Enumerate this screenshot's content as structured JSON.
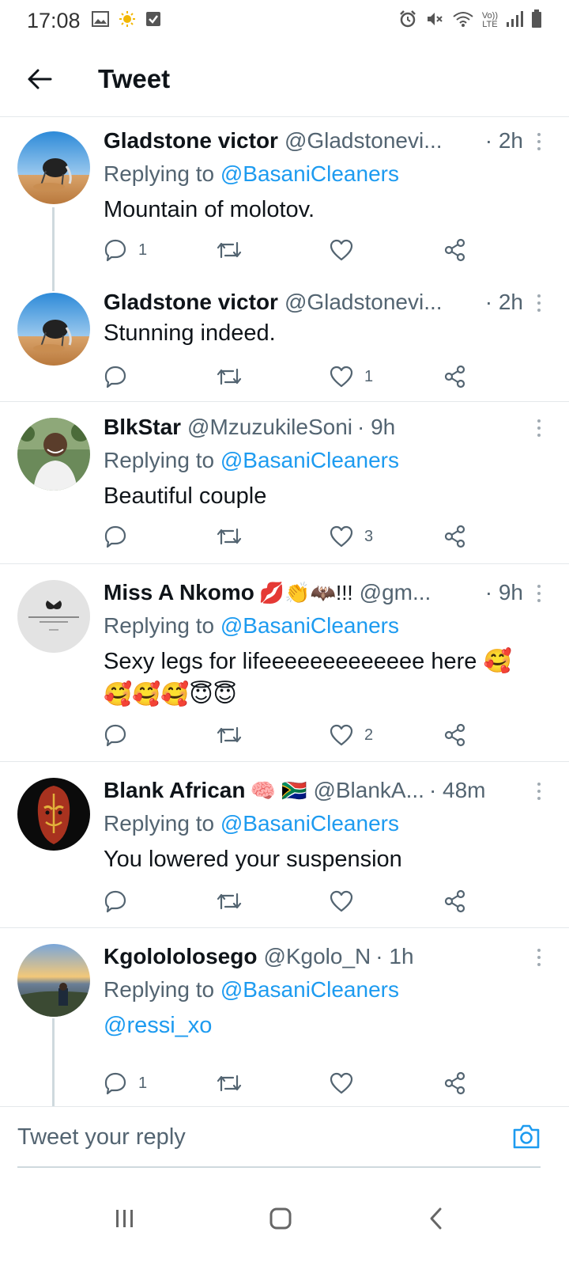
{
  "status_bar": {
    "time": "17:08",
    "left_icons": [
      "image-icon",
      "sun-icon",
      "check-box-icon"
    ],
    "right_icons": [
      "alarm-icon",
      "mute-icon",
      "wifi-icon",
      "volte-icon",
      "signal-icon",
      "battery-icon"
    ],
    "volte_label": "Vo))\nLTE"
  },
  "header": {
    "title": "Tweet"
  },
  "tweets": [
    {
      "name": "Gladstone victor",
      "emojis": "",
      "handle": "@Gladstonevi...",
      "time": "· 2h",
      "replying_prefix": "Replying to ",
      "replying_to": "@BasaniCleaners",
      "text": "Mountain of molotov.",
      "counts": {
        "reply": "1",
        "retweet": "",
        "like": ""
      }
    },
    {
      "name": "Gladstone victor",
      "emojis": "",
      "handle": "@Gladstonevi...",
      "time": "· 2h",
      "text": "Stunning indeed.",
      "counts": {
        "reply": "",
        "retweet": "",
        "like": "1"
      }
    },
    {
      "name": "BlkStar",
      "emojis": "",
      "handle": "@MzuzukileSoni",
      "time": "· 9h",
      "replying_prefix": "Replying to ",
      "replying_to": "@BasaniCleaners",
      "text": "Beautiful couple",
      "counts": {
        "reply": "",
        "retweet": "",
        "like": "3"
      }
    },
    {
      "name": "Miss A Nkomo",
      "emojis": "💋👏🦇!!!",
      "handle": "@gm...",
      "time": "· 9h",
      "replying_prefix": "Replying to ",
      "replying_to": "@BasaniCleaners",
      "text_line1": "Sexy legs for lifeeeeeeeeeeeee here 🥰",
      "text_line2": "🥰🥰🥰😇😇",
      "counts": {
        "reply": "",
        "retweet": "",
        "like": "2"
      }
    },
    {
      "name": "Blank African",
      "emojis": "🧠 🇿🇦",
      "handle": "@BlankA...",
      "time": "· 48m",
      "replying_prefix": "Replying to ",
      "replying_to": "@BasaniCleaners",
      "text": "You lowered your suspension",
      "counts": {
        "reply": "",
        "retweet": "",
        "like": ""
      }
    },
    {
      "name": "Kgolololosego",
      "emojis": "",
      "handle": "@Kgolo_N",
      "time": "· 1h",
      "replying_prefix": "Replying to ",
      "replying_to": "@BasaniCleaners",
      "text_mention": "@ressi_xo",
      "counts": {
        "reply": "1",
        "retweet": "",
        "like": ""
      }
    }
  ],
  "composer": {
    "placeholder": "Tweet your reply"
  },
  "colors": {
    "accent": "#1d9bf0",
    "text": "#0f1419",
    "secondary": "#536471",
    "divider": "#e4e8eb"
  }
}
